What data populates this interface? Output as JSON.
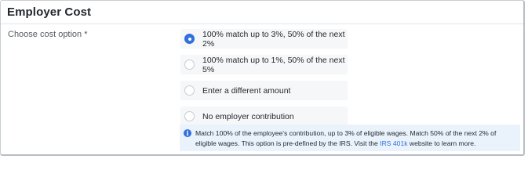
{
  "section": {
    "title": "Employer Cost",
    "field_label": "Choose cost option *"
  },
  "options": [
    {
      "label": "100% match up to 3%, 50% of the next 2%",
      "selected": true
    },
    {
      "label": "100% match up to 1%, 50% of the next 5%",
      "selected": false
    },
    {
      "label": "Enter a different amount",
      "selected": false
    },
    {
      "label": "No employer contribution",
      "selected": false
    }
  ],
  "info": {
    "icon": "info-icon",
    "icon_glyph": "i",
    "text_before": "Match 100% of the employee's contribution, up to 3% of eligible wages. Match 50% of the next 2% of eligible wages. This option is pre-defined by the IRS. Visit the ",
    "link_text": "IRS 401k",
    "text_after": " website to learn more."
  },
  "colors": {
    "accent": "#2f6fde",
    "info_bg": "#eaf3fc",
    "option_bg": "#f6f7f8"
  }
}
